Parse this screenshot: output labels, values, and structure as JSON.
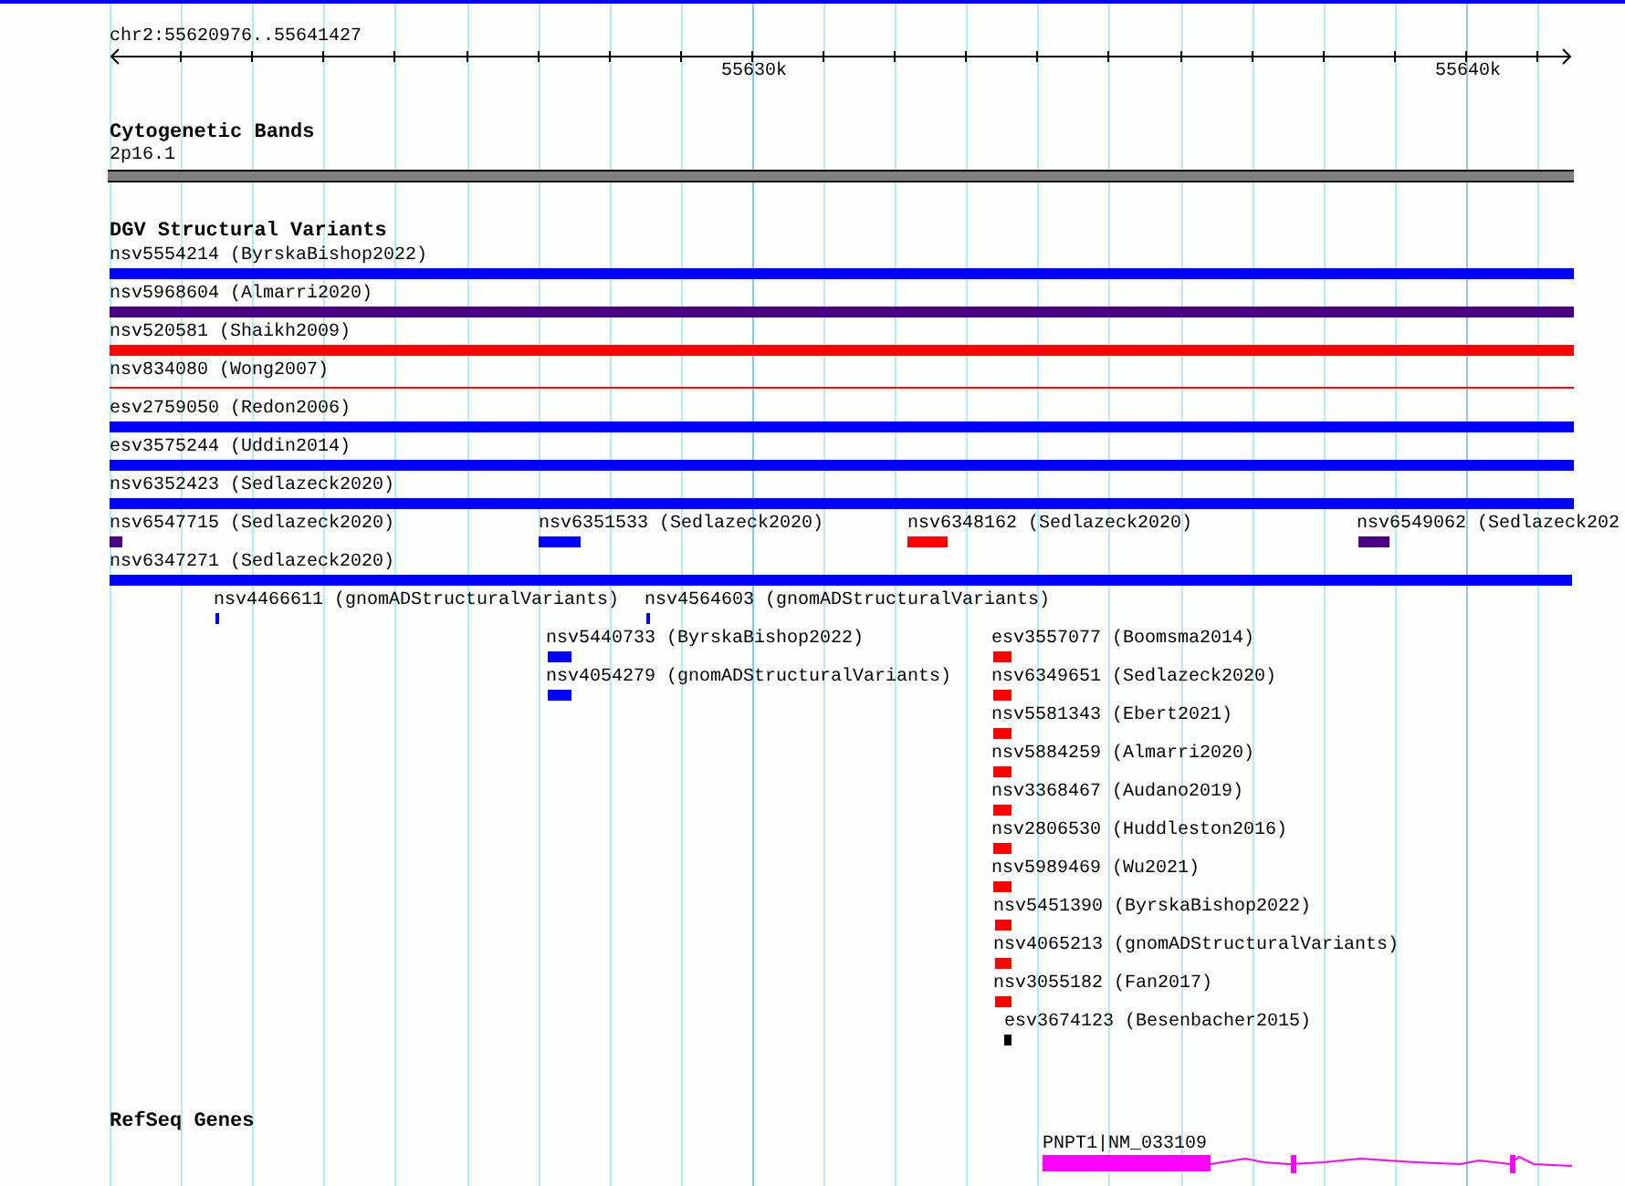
{
  "ruler": {
    "locus": "chr2:55620976..55641427",
    "ticks": [
      "55630k",
      "55640k"
    ]
  },
  "cytoband_track": {
    "title": "Cytogenetic Bands",
    "band": "2p16.1"
  },
  "dgv_track": {
    "title": "DGV Structural Variants",
    "features": [
      {
        "label": "nsv5554214 (ByrskaBishop2022)",
        "color": "#0000ff",
        "kind": "bar"
      },
      {
        "label": "nsv5968604 (Almarri2020)",
        "color": "#4b0082",
        "kind": "bar"
      },
      {
        "label": "nsv520581 (Shaikh2009)",
        "color": "#ff0000",
        "kind": "bar"
      },
      {
        "label": "nsv834080 (Wong2007)",
        "color": "#ff0000",
        "kind": "line"
      },
      {
        "label": "esv2759050 (Redon2006)",
        "color": "#0000ff",
        "kind": "bar"
      },
      {
        "label": "esv3575244 (Uddin2014)",
        "color": "#0000ff",
        "kind": "bar"
      },
      {
        "label": "nsv6352423 (Sedlazeck2020)",
        "color": "#0000ff",
        "kind": "bar"
      },
      {
        "label": "nsv6547715 (Sedlazeck2020)",
        "color": "#4b0082",
        "kind": "bar"
      },
      {
        "label": "nsv6351533 (Sedlazeck2020)",
        "color": "#0000ff",
        "kind": "bar"
      },
      {
        "label": "nsv6348162 (Sedlazeck2020)",
        "color": "#ff0000",
        "kind": "bar"
      },
      {
        "label": "nsv6549062 (Sedlazeck202",
        "color": "#4b0082",
        "kind": "bar"
      },
      {
        "label": "nsv6347271 (Sedlazeck2020)",
        "color": "#0000ff",
        "kind": "bar"
      },
      {
        "label": "nsv4466611 (gnomADStructuralVariants)",
        "color": "#0000ff",
        "kind": "bar"
      },
      {
        "label": "nsv4564603 (gnomADStructuralVariants)",
        "color": "#0000ff",
        "kind": "bar"
      },
      {
        "label": "nsv5440733 (ByrskaBishop2022)",
        "color": "#0000ff",
        "kind": "bar"
      },
      {
        "label": "nsv4054279 (gnomADStructuralVariants)",
        "color": "#0000ff",
        "kind": "bar"
      },
      {
        "label": "esv3557077 (Boomsma2014)",
        "color": "#ff0000",
        "kind": "bar"
      },
      {
        "label": "nsv6349651 (Sedlazeck2020)",
        "color": "#ff0000",
        "kind": "bar"
      },
      {
        "label": "nsv5581343 (Ebert2021)",
        "color": "#ff0000",
        "kind": "bar"
      },
      {
        "label": "nsv5884259 (Almarri2020)",
        "color": "#ff0000",
        "kind": "bar"
      },
      {
        "label": "nsv3368467 (Audano2019)",
        "color": "#ff0000",
        "kind": "bar"
      },
      {
        "label": "nsv2806530 (Huddleston2016)",
        "color": "#ff0000",
        "kind": "bar"
      },
      {
        "label": "nsv5989469 (Wu2021)",
        "color": "#ff0000",
        "kind": "bar"
      },
      {
        "label": "nsv5451390 (ByrskaBishop2022)",
        "color": "#ff0000",
        "kind": "bar"
      },
      {
        "label": "nsv4065213 (gnomADStructuralVariants)",
        "color": "#ff0000",
        "kind": "bar"
      },
      {
        "label": "nsv3055182 (Fan2017)",
        "color": "#ff0000",
        "kind": "bar"
      },
      {
        "label": "esv3674123 (Besenbacher2015)",
        "color": "#000000",
        "kind": "bar"
      }
    ]
  },
  "refseq_track": {
    "title": "RefSeq Genes",
    "genes": [
      {
        "label": "PNPT1|NM_033109"
      }
    ]
  }
}
